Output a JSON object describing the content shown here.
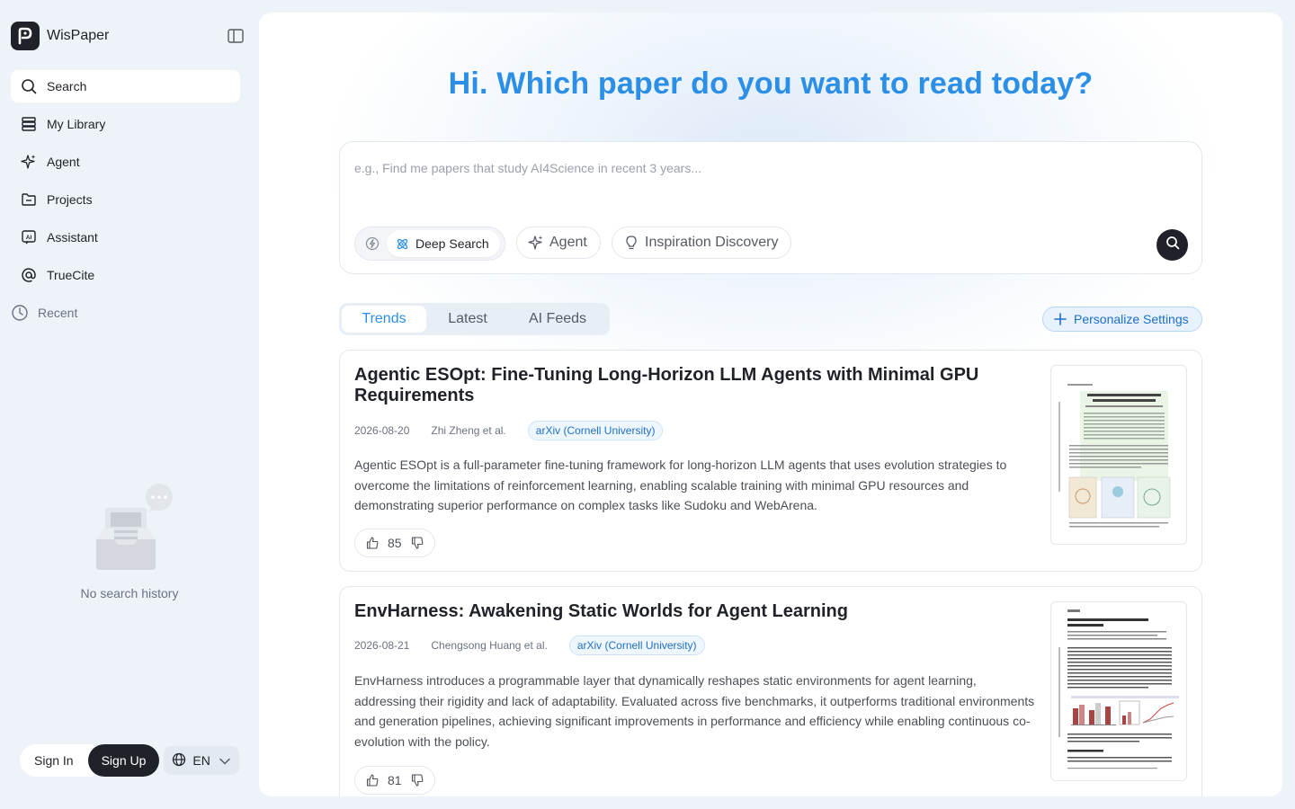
{
  "app": {
    "name": "WisPaper"
  },
  "sidebar": {
    "items": [
      {
        "label": "Search",
        "icon": "search-icon",
        "active": true
      },
      {
        "label": "My Library",
        "icon": "library-icon"
      },
      {
        "label": "Agent",
        "icon": "sparkle-icon"
      },
      {
        "label": "Projects",
        "icon": "folder-icon"
      },
      {
        "label": "Assistant",
        "icon": "ai-icon"
      },
      {
        "label": "TrueCite",
        "icon": "at-icon"
      }
    ],
    "recent_label": "Recent",
    "empty_text": "No search history"
  },
  "auth": {
    "sign_in": "Sign In",
    "sign_up": "Sign Up",
    "language": "EN"
  },
  "hero": {
    "title": "Hi. Which paper do you want to read today?"
  },
  "search": {
    "placeholder": "e.g., Find me papers that study AI4Science in recent 3 years...",
    "mode_deep": "Deep Search",
    "chip_agent": "Agent",
    "chip_inspiration": "Inspiration Discovery"
  },
  "tabs": [
    "Trends",
    "Latest",
    "AI Feeds"
  ],
  "personalize": "Personalize Settings",
  "papers": [
    {
      "title": "Agentic ESOpt: Fine-Tuning Long-Horizon LLM Agents with Minimal GPU Requirements",
      "date": "2026-08-20",
      "authors": "Zhi Zheng et al.",
      "source": "arXiv (Cornell University)",
      "summary": "Agentic ESOpt is a full-parameter fine-tuning framework for long-horizon LLM agents that uses evolution strategies to overcome the limitations of reinforcement learning, enabling scalable training with minimal GPU resources and demonstrating superior performance on complex tasks like Sudoku and WebArena.",
      "likes": "85"
    },
    {
      "title": "EnvHarness: Awakening Static Worlds for Agent Learning",
      "date": "2026-08-21",
      "authors": "Chengsong Huang et al.",
      "source": "arXiv (Cornell University)",
      "summary": "EnvHarness introduces a programmable layer that dynamically reshapes static environments for agent learning, addressing their rigidity and lack of adaptability. Evaluated across five benchmarks, it outperforms traditional environments and generation pipelines, achieving significant improvements in performance and efficiency while enabling continuous co-evolution with the policy.",
      "likes": "81"
    }
  ],
  "colors": {
    "accent": "#2b8fe8",
    "dark": "#1f2329",
    "sidebar_bg": "#eef3f9",
    "badge_text": "#1f6fc5"
  }
}
